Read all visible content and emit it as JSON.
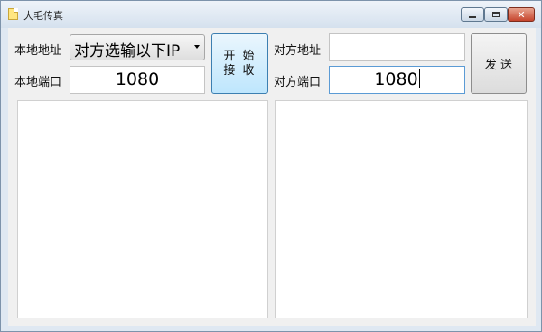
{
  "window": {
    "title": "大毛传真",
    "icon": "document-icon",
    "controls": {
      "minimize": "minimize-icon",
      "maximize": "maximize-icon",
      "close": "close-icon"
    }
  },
  "local": {
    "address_label": "本地地址",
    "address_selected": "对方选输以下IP",
    "port_label": "本地端口",
    "port_value": "1080"
  },
  "remote": {
    "address_label": "对方地址",
    "address_value": "",
    "port_label": "对方端口",
    "port_value": "1080"
  },
  "buttons": {
    "start_receive": "开 始 接 收",
    "send": "发 送"
  },
  "panes": {
    "left_text": "",
    "right_text": ""
  },
  "colors": {
    "title_bar": "#dfe8f2",
    "close_button": "#c6452d",
    "receive_button": "#bee6fd"
  }
}
